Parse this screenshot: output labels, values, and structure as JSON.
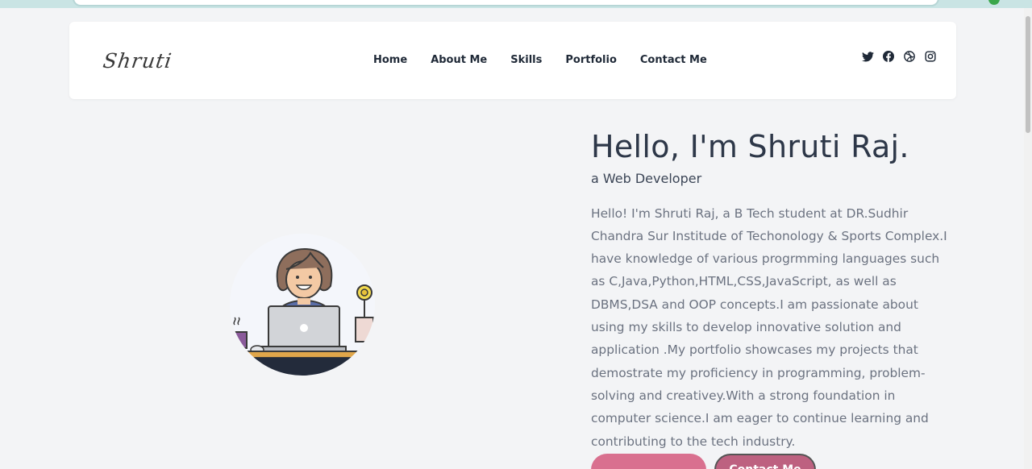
{
  "brand": {
    "logo_text": "Shruti"
  },
  "nav": {
    "items": [
      {
        "label": "Home"
      },
      {
        "label": "About Me"
      },
      {
        "label": "Skills"
      },
      {
        "label": "Portfolio"
      },
      {
        "label": "Contact Me"
      }
    ]
  },
  "socials": [
    "twitter-icon",
    "facebook-icon",
    "dribbble-icon",
    "instagram-icon"
  ],
  "hero": {
    "title": "Hello, I'm Shruti Raj.",
    "subtitle": "a Web Developer",
    "description": "Hello! I'm Shruti Raj, a B Tech student at DR.Sudhir Chandra Sur Institude of Techonology & Sports Complex.I have knowledge of various progrmming languages such as C,Java,Python,HTML,CSS,JavaScript, as well as DBMS,DSA and OOP concepts.I am passionate about using my skills to develop innovative solution and application .My portfolio showcases my projects that demostrate my proficiency in programming, problem-solving and creativey.With a strong foundation in computer science.I am eager to continue learning and contributing to the tech industry.",
    "buttons": [
      {
        "label": ""
      },
      {
        "label": "Contact Me"
      }
    ]
  },
  "colors": {
    "accent": "#d9708f",
    "accent_dark": "#bd6180",
    "page_bg": "#f3f4f6"
  }
}
